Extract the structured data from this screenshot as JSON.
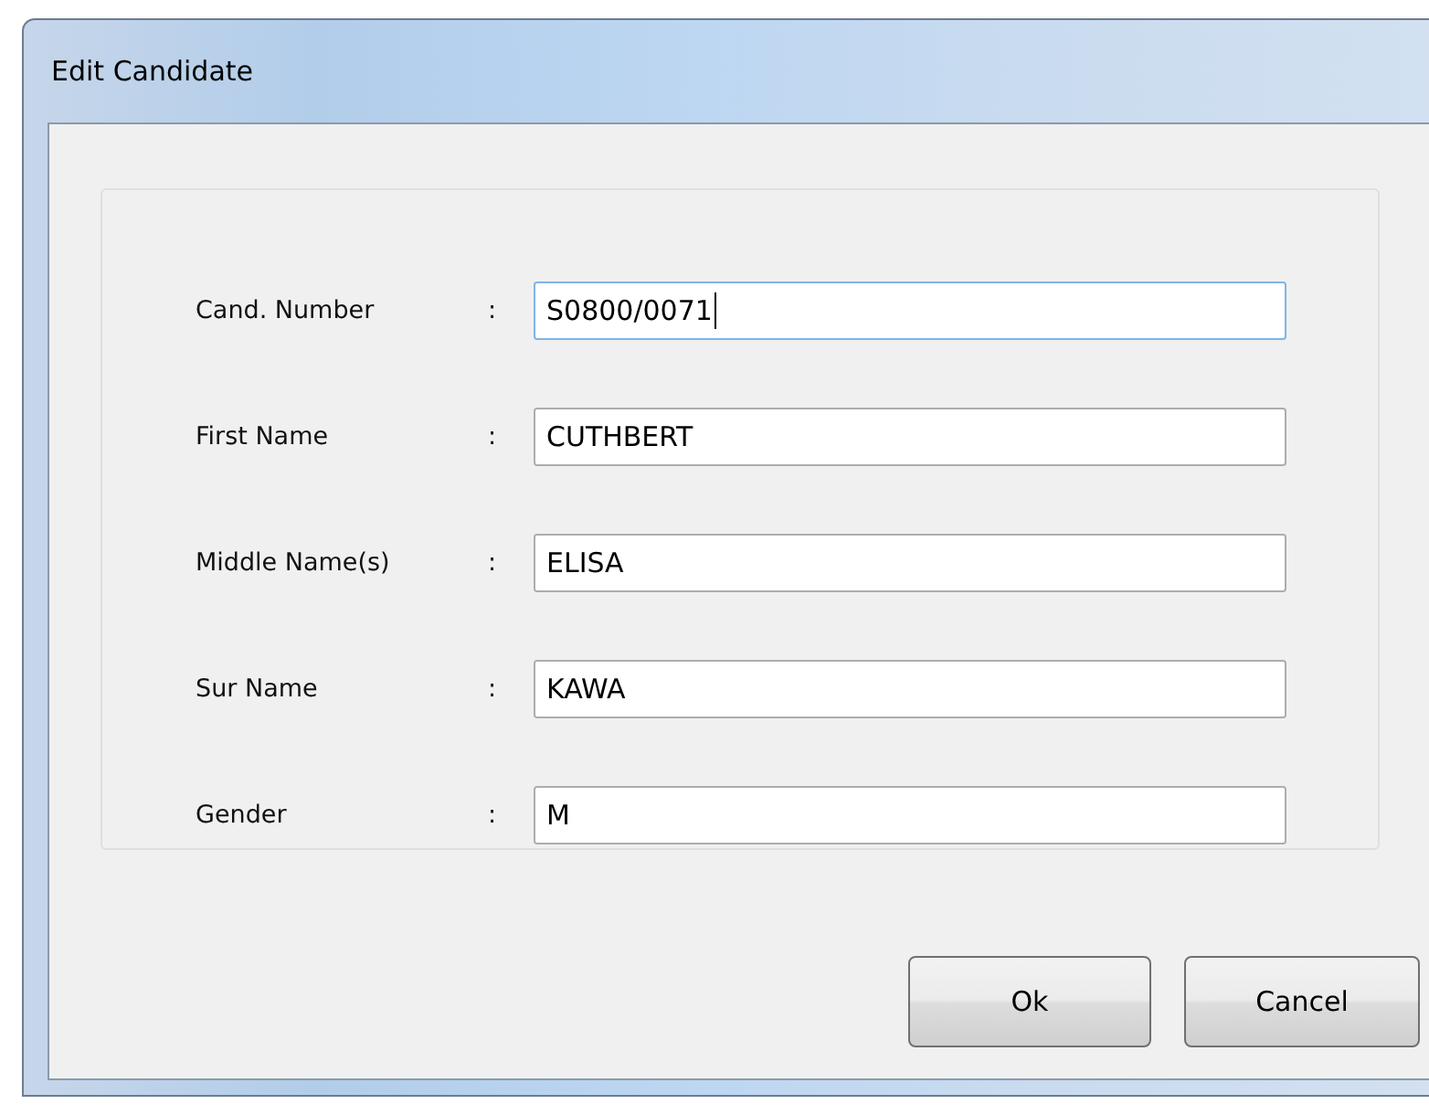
{
  "window": {
    "title": "Edit Candidate"
  },
  "fields": [
    {
      "label": "Cand. Number",
      "separator": ":",
      "value": "S0800/0071",
      "focused": true
    },
    {
      "label": "First Name",
      "separator": ":",
      "value": "CUTHBERT",
      "focused": false
    },
    {
      "label": "Middle Name(s)",
      "separator": ":",
      "value": "ELISA",
      "focused": false
    },
    {
      "label": "Sur Name",
      "separator": ":",
      "value": "KAWA",
      "focused": false
    },
    {
      "label": "Gender",
      "separator": ":",
      "value": "M",
      "focused": false
    }
  ],
  "buttons": [
    "Ok",
    "Cancel"
  ]
}
